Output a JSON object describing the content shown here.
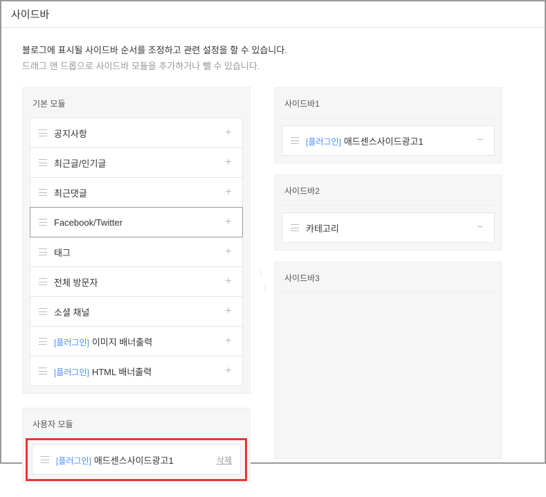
{
  "window": {
    "title": "사이드바"
  },
  "description": {
    "main": "블로그에 표시될 사이드바 순서를 조정하고 관련 설정을 할 수 있습니다.",
    "sub": "드래그 앤 드롭으로 사이드바 모듈을 추가하거나 뺄 수 있습니다."
  },
  "left": {
    "basic_header": "기본 모듈",
    "user_header": "사용자 모듈",
    "plugin_tag": "[플러그인]",
    "items": [
      {
        "label": "공지사항"
      },
      {
        "label": "최근글/인기글"
      },
      {
        "label": "최근댓글"
      },
      {
        "label": "Facebook/Twitter"
      },
      {
        "label": "태그"
      },
      {
        "label": "전체 방문자"
      },
      {
        "label": "소셜 채널"
      },
      {
        "label": "이미지 배너출력"
      },
      {
        "label": "HTML 배너출력"
      }
    ],
    "user_item_label": "애드센스사이드광고1",
    "delete_label": "삭제"
  },
  "right": {
    "section1": "사이드바1",
    "section2": "사이드바2",
    "section3": "사이드바3",
    "plugin_tag": "[플러그인]",
    "s1_item_label": "애드센스사이드광고1",
    "s2_item_label": "카테고리"
  }
}
